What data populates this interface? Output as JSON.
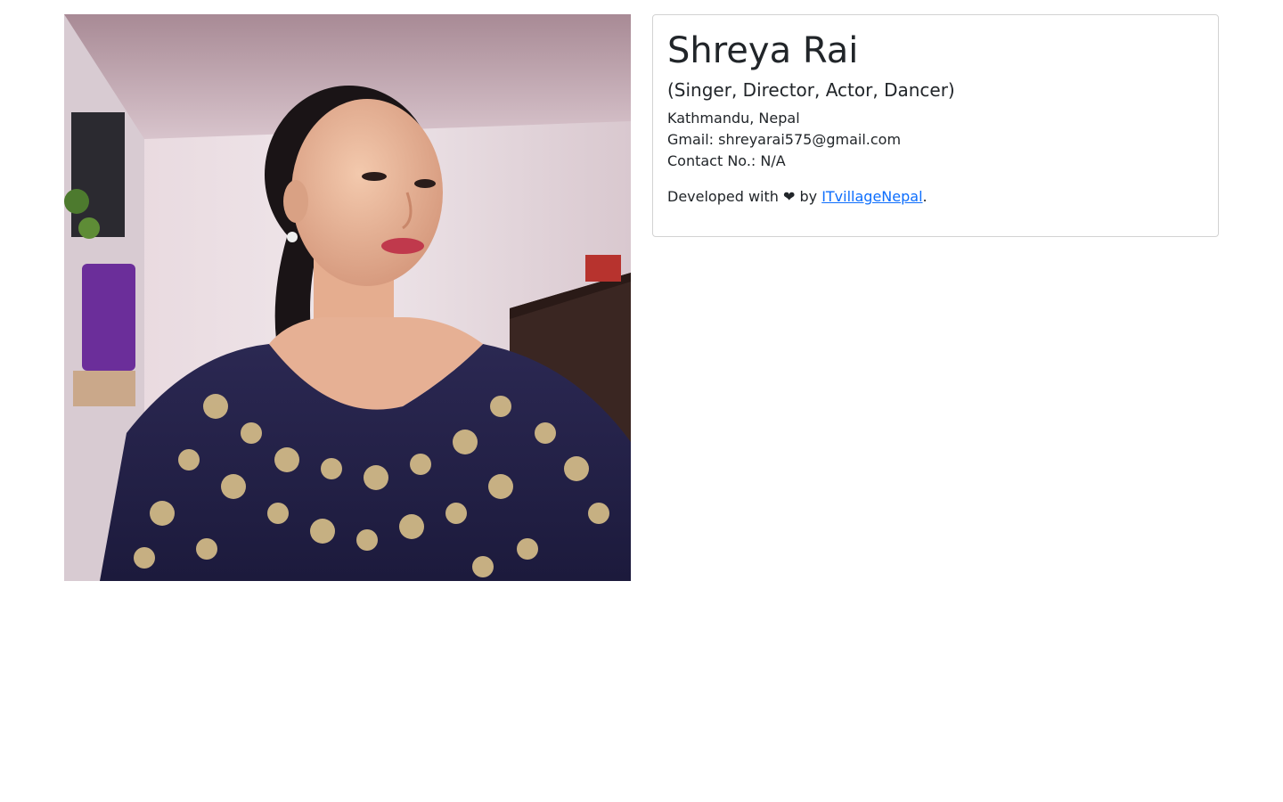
{
  "profile": {
    "photo_alt": "Shreya Rai",
    "name": "Shreya Rai",
    "roles": "(Singer, Director, Actor, Dancer)",
    "location": "Kathmandu, Nepal",
    "gmail": "Gmail: shreyarai575@gmail.com",
    "contact": "Contact No.: N/A"
  },
  "footer": {
    "prefix": "Developed with ❤ by ",
    "link_text": "ITvillageNepal",
    "suffix": "."
  },
  "colors": {
    "link": "#0d6efd",
    "text": "#212529",
    "border": "#d9d9d9"
  }
}
